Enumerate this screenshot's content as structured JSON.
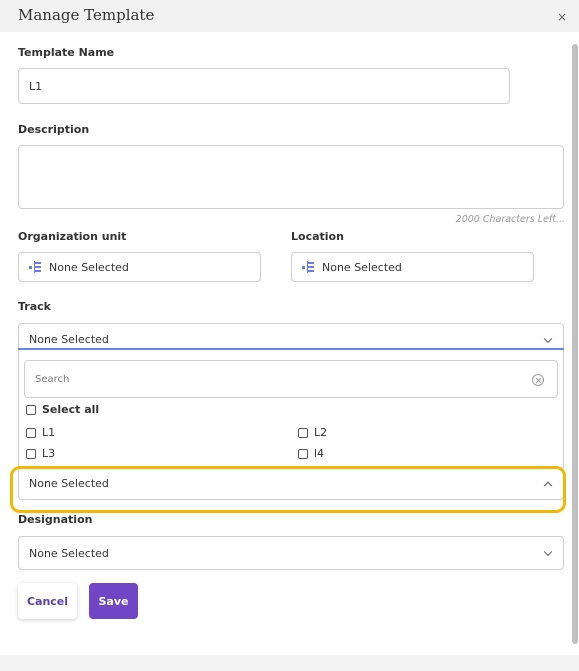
{
  "dialog": {
    "title": "Manage Template",
    "close_glyph": "×"
  },
  "template_name": {
    "label": "Template Name",
    "value": "L1"
  },
  "description": {
    "label": "Description",
    "value": "",
    "chars_left": "2000 Characters Left..."
  },
  "organization_unit": {
    "label": "Organization unit",
    "value": "None Selected"
  },
  "location": {
    "label": "Location",
    "value": "None Selected"
  },
  "track": {
    "label": "Track",
    "value": "None Selected"
  },
  "track_dropdown": {
    "search_placeholder": "Search",
    "select_all": "Select all",
    "options": [
      "L1",
      "L2",
      "L3",
      "l4"
    ]
  },
  "level_select": {
    "value": "None Selected"
  },
  "designation": {
    "label": "Designation",
    "value": "None Selected"
  },
  "buttons": {
    "cancel": "Cancel",
    "save": "Save"
  },
  "colors": {
    "accent": "#7046c6",
    "highlight": "#f2b705",
    "focus_line": "#6a86e0"
  }
}
